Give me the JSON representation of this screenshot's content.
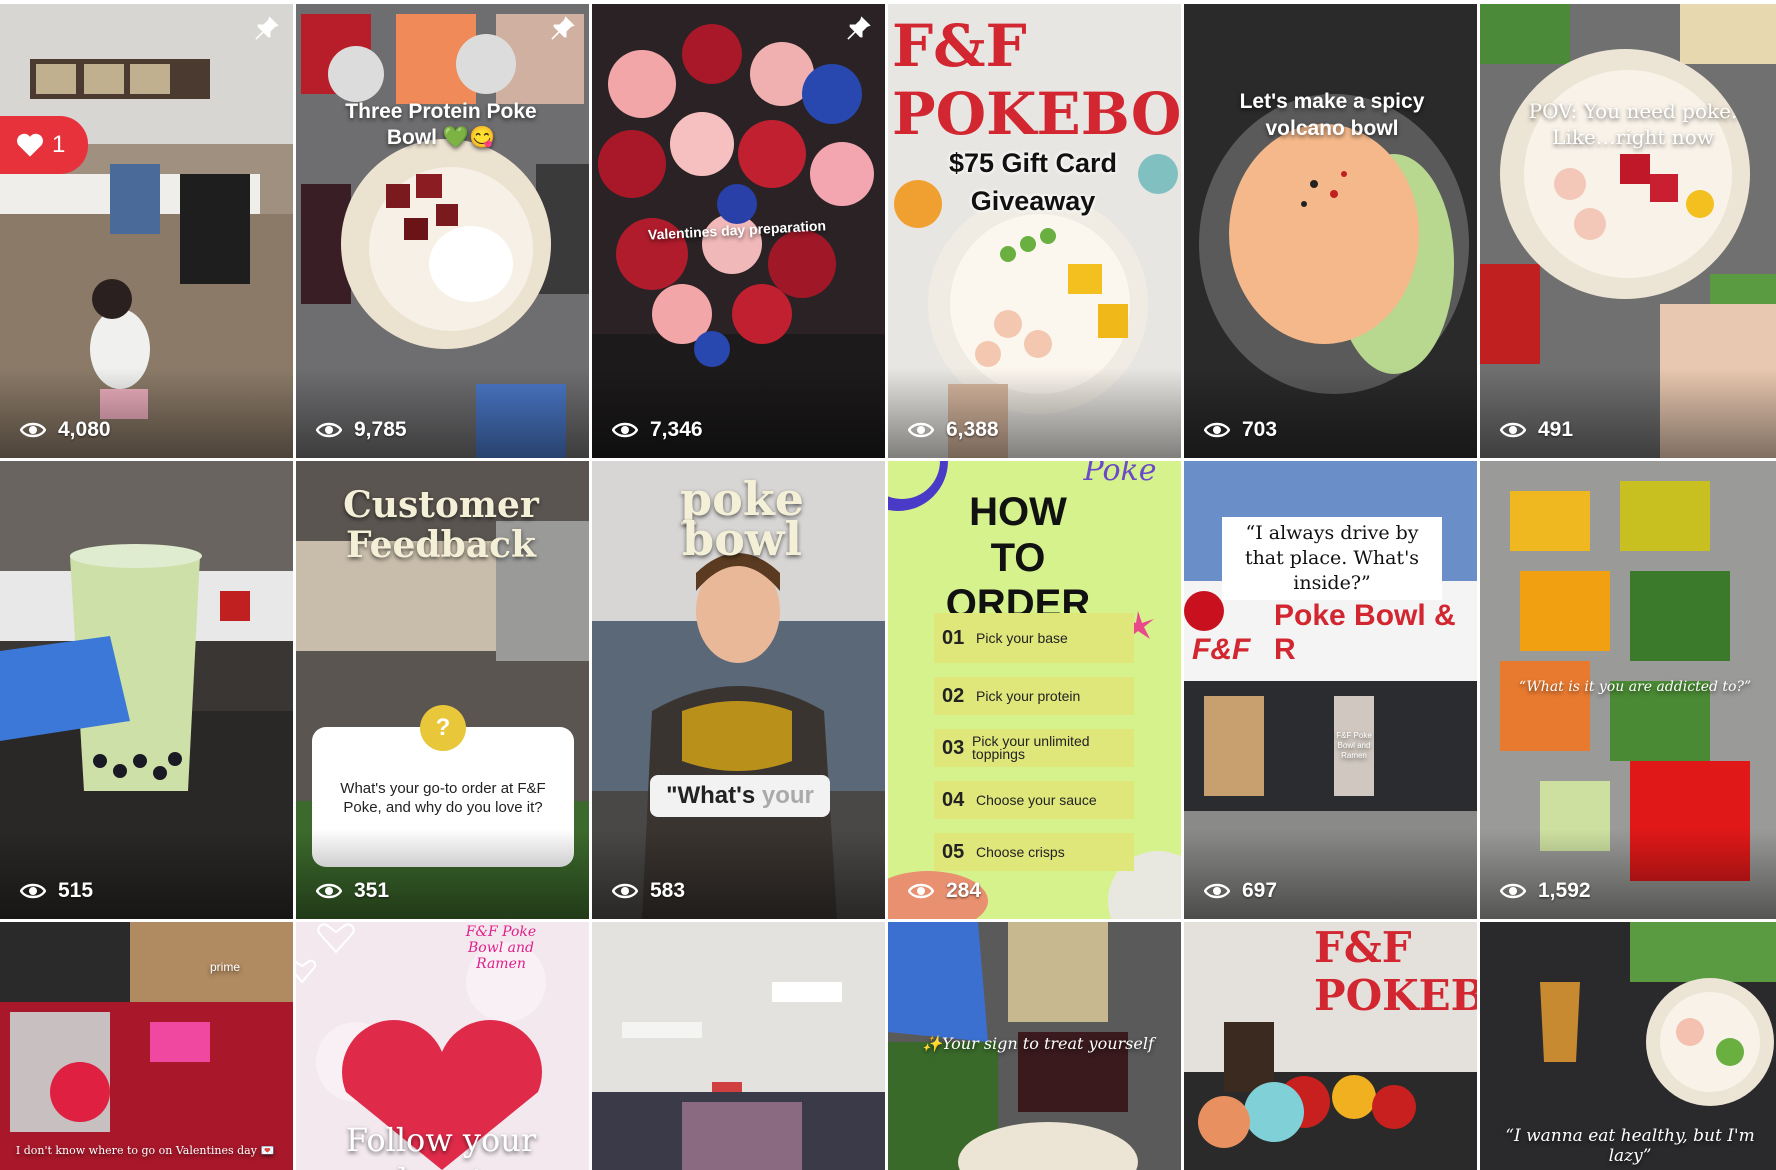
{
  "tiles": [
    {
      "views": "4,080",
      "pinned": true,
      "likes": "1"
    },
    {
      "views": "9,785",
      "pinned": true,
      "caption": "Three Protein Poke Bowl 💚😋"
    },
    {
      "views": "7,346",
      "pinned": true,
      "caption": "Valentines day preparation"
    },
    {
      "views": "6,388",
      "sign": "F&F POKEBO",
      "caption": "$75 Gift Card Giveaway"
    },
    {
      "views": "703",
      "caption": "Let's make a spicy volcano bowl"
    },
    {
      "views": "491",
      "caption": "POV: You need poke. Like…right now"
    },
    {
      "views": "515"
    },
    {
      "views": "351",
      "title": "Customer Feedback",
      "question": "What's your go-to order at F&F Poke, and why do you love it?",
      "qmark": "?"
    },
    {
      "views": "583",
      "title": "poke bowl",
      "caption_a": "\"What's",
      "caption_b": "your"
    },
    {
      "views": "284",
      "title": "HOW TO ORDER",
      "corner": "Poke",
      "steps": [
        {
          "n": "01",
          "text": "Pick your base"
        },
        {
          "n": "02",
          "text": "Pick your protein"
        },
        {
          "n": "03",
          "text": "Pick your unlimited toppings"
        },
        {
          "n": "04",
          "text": "Choose your sauce"
        },
        {
          "n": "05",
          "text": "Choose crisps"
        }
      ]
    },
    {
      "views": "697",
      "quote": "“I always drive by that place. What's inside?”",
      "sign": "Poke Bowl & R",
      "sign2": "F&F",
      "store": "F&F Poke Bowl and Ramen"
    },
    {
      "views": "1,592",
      "caption": "“What is it you are addicted to?”"
    },
    {
      "caption": "I don't know where to go on Valentines day 💌",
      "brand": "prime"
    },
    {
      "brand": "F&F Poke Bowl and Ramen",
      "caption": "Follow your heart"
    },
    {},
    {
      "caption": "✨Your sign to treat yourself"
    },
    {
      "sign": "F&F POKEBO"
    },
    {
      "caption": "“I wanna eat healthy, but I'm lazy”"
    }
  ]
}
